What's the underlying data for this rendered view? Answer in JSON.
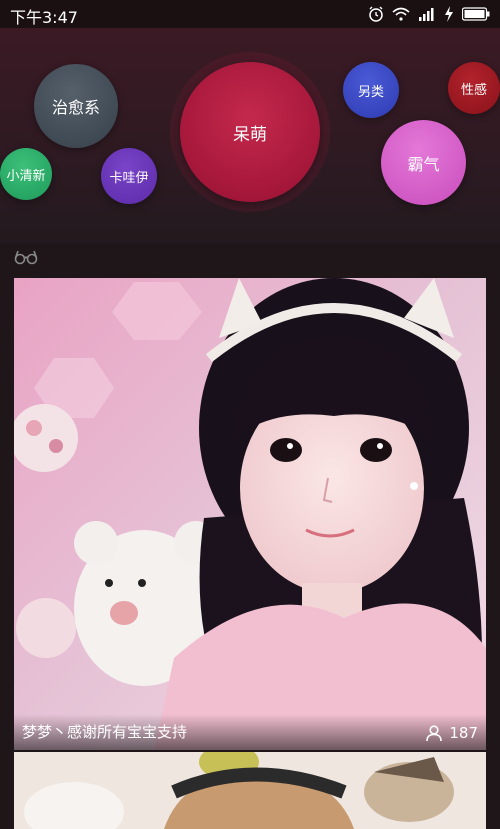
{
  "status_bar": {
    "time": "下午3:47",
    "icons": [
      "alarm-icon",
      "wifi-icon",
      "signal-icon",
      "charging-icon",
      "battery-icon"
    ]
  },
  "categories": {
    "selected": "呆萌",
    "items": [
      {
        "label": "治愈系",
        "color": "#46505a"
      },
      {
        "label": "呆萌",
        "color": "#a5173a"
      },
      {
        "label": "另类",
        "color": "#3a4ac4"
      },
      {
        "label": "性感",
        "color": "#9e1a22"
      },
      {
        "label": "小清新",
        "color": "#27ad66"
      },
      {
        "label": "卡哇伊",
        "color": "#6a36b8"
      },
      {
        "label": "霸气",
        "color": "#d862ca"
      }
    ]
  },
  "section_icon": "glasses-icon",
  "feed": [
    {
      "title": "梦梦丶感谢所有宝宝支持",
      "viewers": "187",
      "viewer_icon": "person-icon"
    },
    {
      "title": "",
      "viewers": ""
    }
  ]
}
